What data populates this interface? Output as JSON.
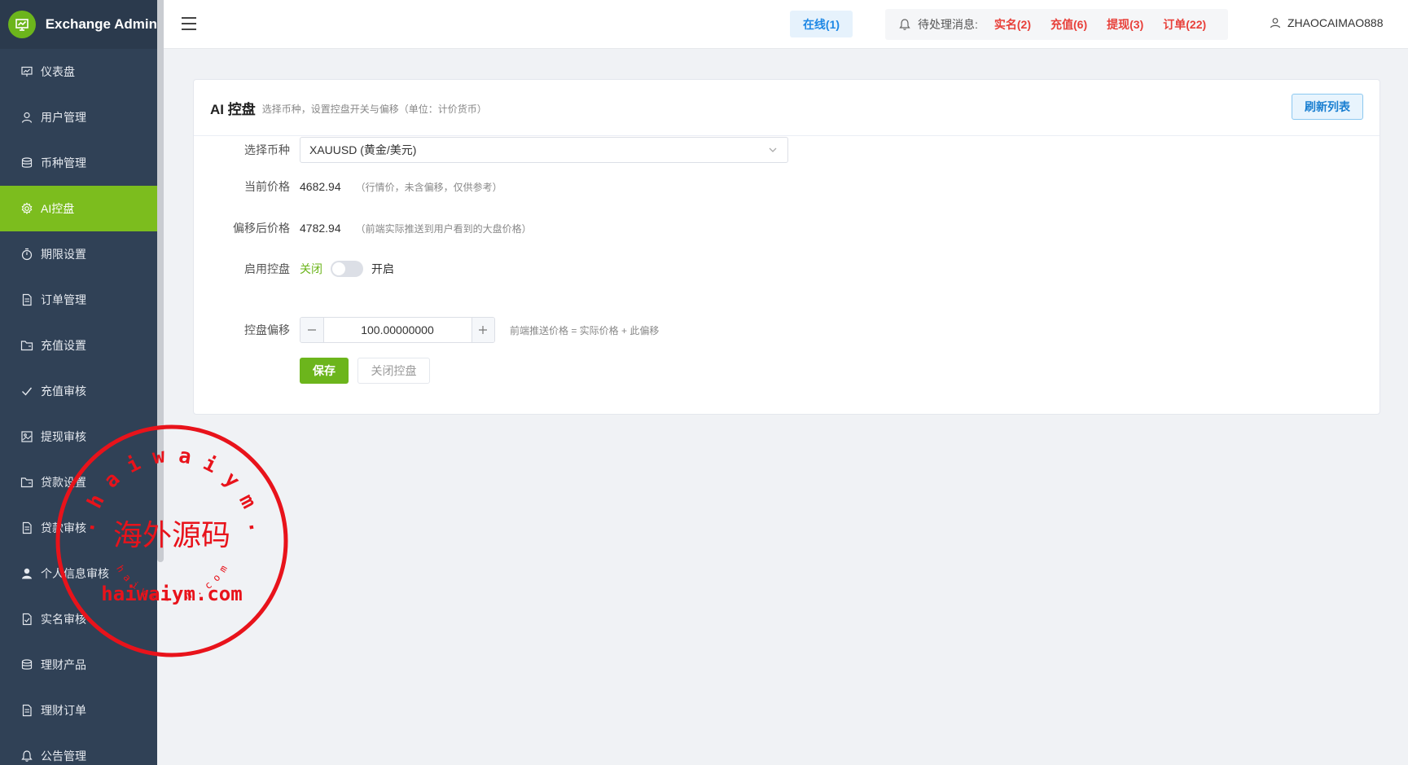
{
  "brand": {
    "title": "Exchange Admin"
  },
  "sidebar": {
    "items": [
      {
        "label": "仪表盘",
        "icon": "chart-icon",
        "active": false
      },
      {
        "label": "用户管理",
        "icon": "user-icon",
        "active": false
      },
      {
        "label": "币种管理",
        "icon": "database-icon",
        "active": false
      },
      {
        "label": "AI控盘",
        "icon": "gear-icon",
        "active": true
      },
      {
        "label": "期限设置",
        "icon": "timer-icon",
        "active": false
      },
      {
        "label": "订单管理",
        "icon": "document-icon",
        "active": false
      },
      {
        "label": "充值设置",
        "icon": "folder-icon",
        "active": false
      },
      {
        "label": "充值审核",
        "icon": "check-icon",
        "active": false
      },
      {
        "label": "提现审核",
        "icon": "picture-icon",
        "active": false
      },
      {
        "label": "贷款设置",
        "icon": "folder-icon",
        "active": false
      },
      {
        "label": "贷款审核",
        "icon": "document-icon",
        "active": false
      },
      {
        "label": "个人信息审核",
        "icon": "person-fill-icon",
        "active": false
      },
      {
        "label": "实名审核",
        "icon": "document-check-icon",
        "active": false
      },
      {
        "label": "理财产品",
        "icon": "database-icon",
        "active": false
      },
      {
        "label": "理财订单",
        "icon": "document-icon",
        "active": false
      },
      {
        "label": "公告管理",
        "icon": "bell-icon",
        "active": false
      }
    ]
  },
  "header": {
    "online": "在线(1)",
    "notice_label": "待处理消息:",
    "notices": [
      "实名(2)",
      "充值(6)",
      "提现(3)",
      "订单(22)"
    ],
    "username": "ZHAOCAIMAO888"
  },
  "card": {
    "title": "AI 控盘",
    "subtitle": "选择币种，设置控盘开关与偏移（单位：计价货币）",
    "refresh_label": "刷新列表",
    "form": {
      "coin_label": "选择币种",
      "coin_value": "XAUUSD (黄金/美元)",
      "current_label": "当前价格",
      "current_value": "4682.94",
      "current_hint": "（行情价，未含偏移，仅供参考）",
      "offset_price_label": "偏移后价格",
      "offset_price_value": "4782.94",
      "offset_price_hint": "（前端实际推送到用户看到的大盘价格）",
      "enable_label": "启用控盘",
      "enable_off": "关闭",
      "enable_on": "开启",
      "enabled": false,
      "offset_label": "控盘偏移",
      "offset_value": "100.00000000",
      "offset_hint": "前端推送价格 = 实际价格 + 此偏移",
      "save_label": "保存",
      "close_label": "关闭控盘"
    }
  },
  "watermark": {
    "top_text": "w w w . h a i w a i y m . c o m",
    "center_text": "海外源码",
    "domain_text": "haiwaiym.com",
    "bottom_text": "h a i w a i y m . c o m",
    "color": "#e8131b"
  },
  "colors": {
    "accent": "#7cbd1e",
    "sidebar": "#304156",
    "alert": "#e8403a",
    "link": "#1e88e5"
  }
}
